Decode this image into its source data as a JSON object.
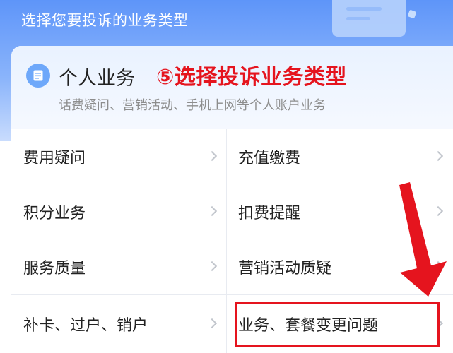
{
  "header": {
    "title": "选择您要投诉的业务类型"
  },
  "category": {
    "title": "个人业务",
    "subtitle": "话费疑问、营销活动、手机上网等个人账户业务",
    "icon": "document-icon"
  },
  "annotation": {
    "text": "⑤选择投诉业务类型",
    "color": "#e5141e"
  },
  "items": [
    {
      "label": "费用疑问"
    },
    {
      "label": "充值缴费"
    },
    {
      "label": "积分业务"
    },
    {
      "label": "扣费提醒"
    },
    {
      "label": "服务质量"
    },
    {
      "label": "营销活动质疑"
    },
    {
      "label": "补卡、过户、销户"
    },
    {
      "label": "业务、套餐变更问题"
    }
  ],
  "highlighted_item": "业务、套餐变更问题",
  "colors": {
    "accent": "#5e95f9",
    "annotation_red": "#e5141e"
  }
}
